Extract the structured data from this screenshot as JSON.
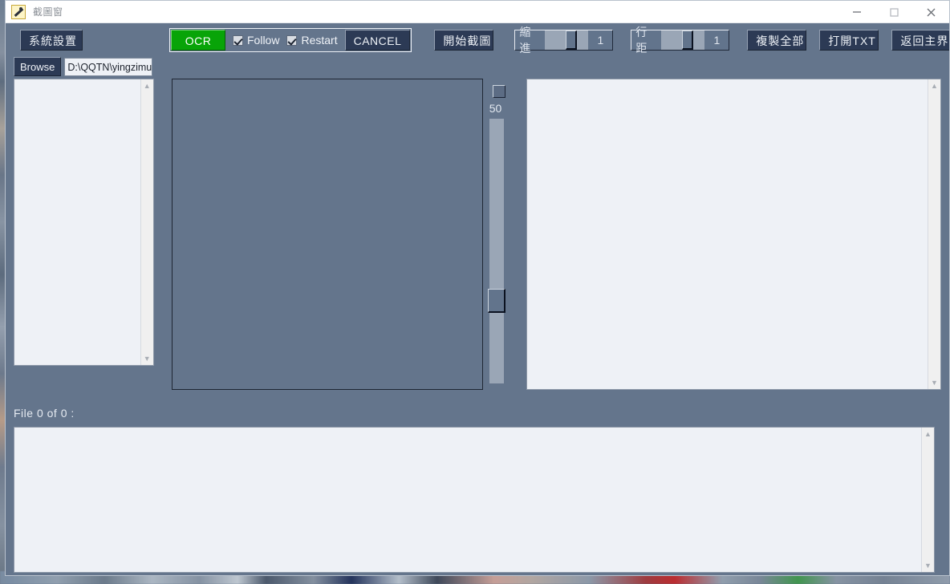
{
  "window": {
    "title": "截圖窗",
    "icon": "screenshot-tool-icon",
    "controls": {
      "minimize": "minimize-icon",
      "maximize": "maximize-icon",
      "close": "close-icon"
    }
  },
  "toolbar": {
    "system_settings": "系統設置",
    "ocr": "OCR",
    "follow_label": "Follow",
    "follow_checked": true,
    "restart_label": "Restart",
    "restart_checked": true,
    "cancel": "CANCEL",
    "start_capture": "開始截圖",
    "indent": {
      "label": "縮進",
      "value": "1"
    },
    "line_spacing": {
      "label": "行距",
      "value": "1"
    },
    "copy_all": "複製全部",
    "open_txt": "打開TXT",
    "back_to_main": "返回主界面"
  },
  "path_row": {
    "browse_label": "Browse",
    "path_value": "D:\\QQTN\\yingzimu",
    "path_placeholder": "D:\\"
  },
  "panels": {
    "file_list_items": [],
    "preview_alt": "capture-preview-empty",
    "result_text": "",
    "vertical_slider": {
      "value": "50",
      "toggle": "vslider-toggle"
    }
  },
  "status": {
    "file_counter": "File  0  of  0 :"
  },
  "text_output": {
    "content": ""
  },
  "colors": {
    "window_bg": "#64758c",
    "button_bg": "#2c3a55",
    "ocr_green": "#08a408",
    "panel_bg": "#eef1f6",
    "titlebar_bg": "#ffffff"
  }
}
